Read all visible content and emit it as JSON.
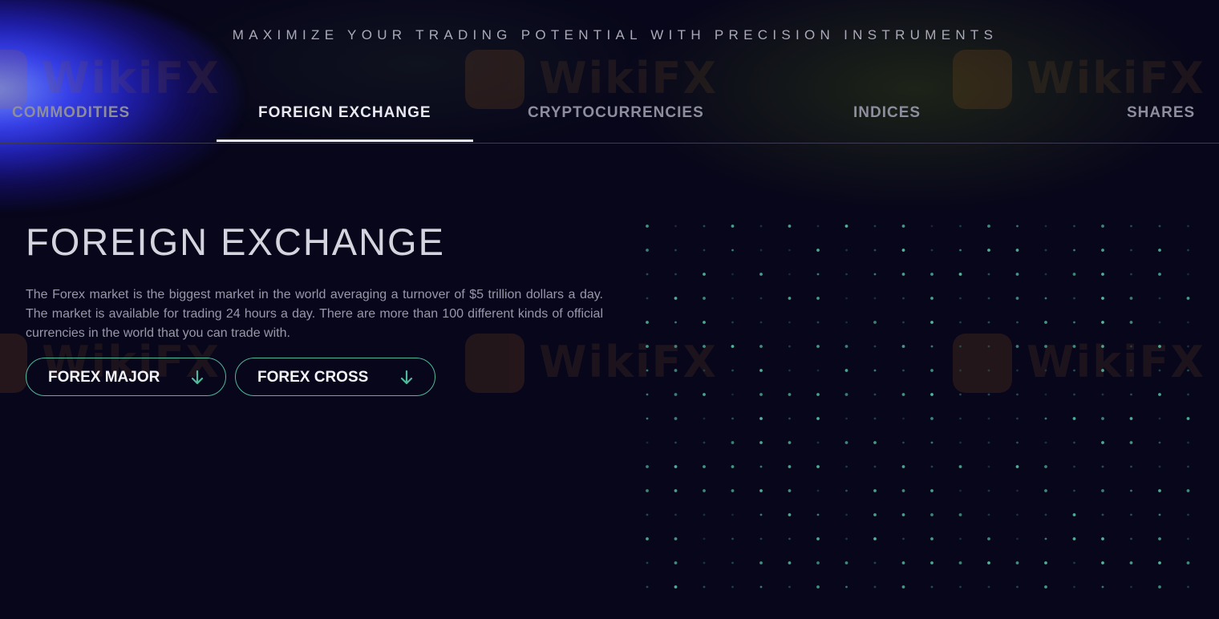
{
  "header": {
    "tagline": "MAXIMIZE YOUR TRADING POTENTIAL WITH PRECISION INSTRUMENTS"
  },
  "tabs": [
    {
      "label": "COMMODITIES",
      "active": false
    },
    {
      "label": "FOREIGN EXCHANGE",
      "active": true
    },
    {
      "label": "CRYPTOCURRENCIES",
      "active": false
    },
    {
      "label": "INDICES",
      "active": false
    },
    {
      "label": "SHARES",
      "active": false
    }
  ],
  "section": {
    "title": "FOREIGN EXCHANGE",
    "description": "The Forex market is the biggest market in the world averaging a turnover of $5 trillion dollars a day. The market is available for trading 24 hours a day. There are more than 100 different kinds of official currencies in the world that you can trade with."
  },
  "buttons": [
    {
      "label": "FOREX MAJOR",
      "icon": "arrow-down-icon"
    },
    {
      "label": "FOREX CROSS",
      "icon": "arrow-down-icon"
    }
  ],
  "watermark": {
    "text": "WikiFX"
  },
  "colors": {
    "background": "#07061a",
    "accent_teal": "#4fb89a",
    "glow_blue": "#3c46ff",
    "text_primary": "#e8e8f0",
    "text_muted": "#8d8d9e"
  }
}
